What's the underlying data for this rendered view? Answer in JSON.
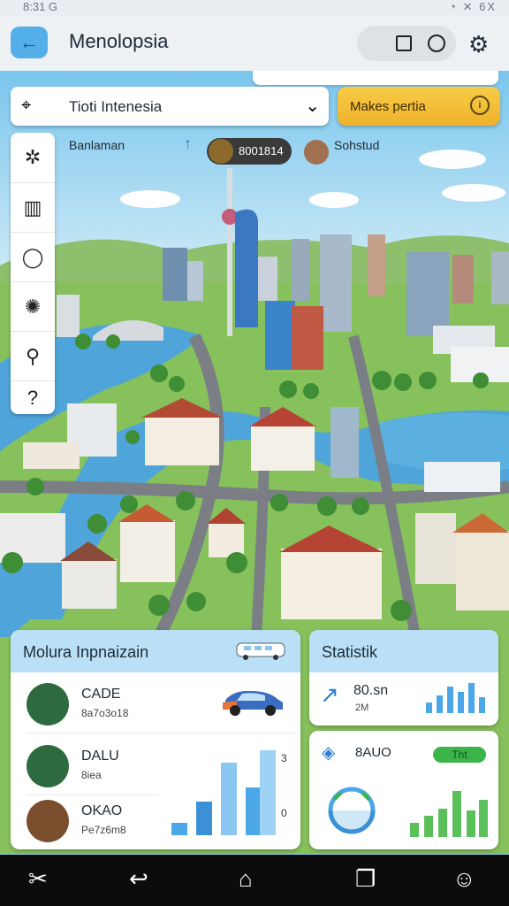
{
  "status": {
    "left": "8:31 G",
    "right": "◔ ✕ 6X"
  },
  "app": {
    "title": "Menolopsia",
    "back_icon": "arrow-left-icon",
    "settings_icon": "gear-icon"
  },
  "location": {
    "value": "Tioti Intenesia"
  },
  "cta": {
    "label": "Makes pertia"
  },
  "info": {
    "place": "Banlaman",
    "chip": "8001814",
    "user": "Sohstud"
  },
  "left_panel": {
    "title": "Molura Inpnaizain",
    "rows": [
      {
        "name": "CADE",
        "sub": "8a7o3o18"
      },
      {
        "name": "DALU",
        "sub": "8iea"
      },
      {
        "name": "OKAO",
        "sub": "Pe7z6m8"
      }
    ],
    "bars_right_label": "3",
    "bars_right_label2": "0"
  },
  "stats_panel": {
    "title": "Statistik",
    "card1": {
      "value": "80.sn",
      "sub": "2M"
    },
    "card2": {
      "value": "8AUO",
      "badge": "Tht"
    }
  },
  "colors": {
    "accent": "#54aee8",
    "cta": "#f3bf3a",
    "badge": "#3bb54a",
    "bar_blue": "#4ba7e8"
  }
}
